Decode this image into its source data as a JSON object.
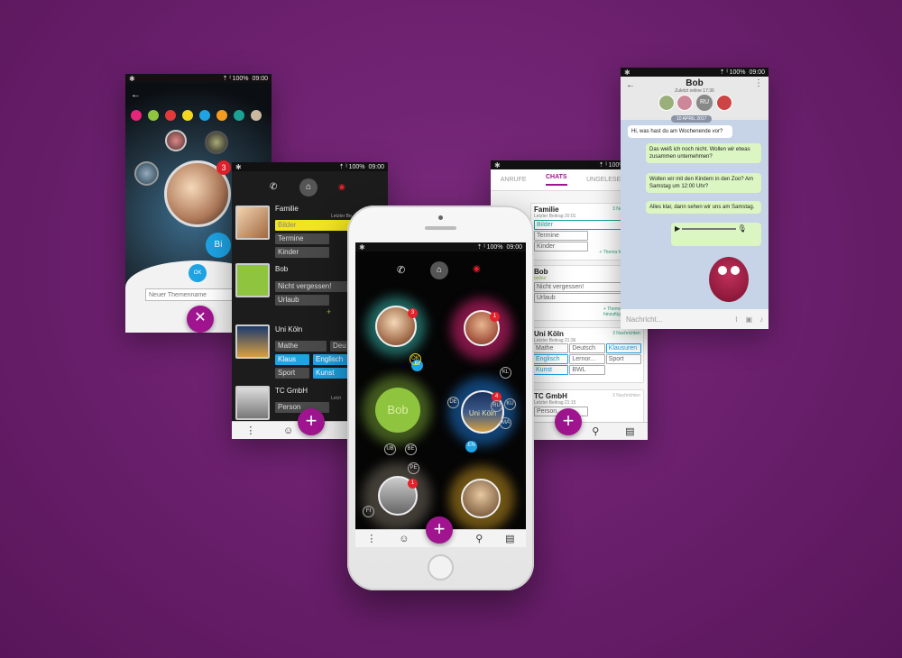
{
  "status": {
    "signal": "⇡ ᴵ 100%",
    "time": "09:00"
  },
  "colors": {
    "accent": "#a0158f",
    "badge": "#e5222c",
    "background": "#6a1f6c",
    "link": "#2aa07a"
  },
  "screenA": {
    "palette": [
      "#e8247b",
      "#8fc43f",
      "#e23a3a",
      "#f2d61f",
      "#1ea3e3",
      "#f39c20",
      "#1aa395",
      "#cbb8a0"
    ],
    "badge": "3",
    "bubble_label": "Bi",
    "ok_label": "OK",
    "topic_placeholder": "Neuer Themenname"
  },
  "screenB": {
    "groups": [
      {
        "name": "Familie",
        "meta": "Letzter Be",
        "tags": [
          "Bilder",
          "Termine",
          "Kinder"
        ]
      },
      {
        "name": "Bob",
        "meta": "",
        "tags": [
          "Nicht vergessen!",
          "Urlaub"
        ]
      },
      {
        "name": "Uni Köln",
        "meta": "",
        "tags": [
          "Mathe",
          "Deu",
          "Klaus",
          "Englisch",
          "Sport",
          "Kunst"
        ]
      },
      {
        "name": "TC GmbH",
        "meta": "Letzt",
        "tags": [
          "Person"
        ]
      }
    ],
    "plus": "+"
  },
  "screenC": {
    "tabs": [
      "ANRUFE",
      "CHATS",
      "UNGELESENE"
    ],
    "unread_badge": "9",
    "chats": [
      {
        "name": "Familie",
        "sub": "Letzter Beitrag 20:01",
        "count": "3 Nachrichten",
        "tags": [
          "Bilder",
          "Termine",
          "Kinder"
        ],
        "link": "+ Thema hinzufügen"
      },
      {
        "name": "Bob",
        "sub": "online",
        "count": "",
        "tags": [
          "Nicht vergessen!",
          "Urlaub"
        ],
        "link": "+ Thema hinzufügen"
      },
      {
        "name": "Uni Köln",
        "sub": "Letzter Beitrag 21:36",
        "count": "3 Nachrichten",
        "tags": [
          "Mathe",
          "Deutsch",
          "Klausuren",
          "Englisch",
          "Lernor...",
          "Sport",
          "Kunst",
          "BWL"
        ],
        "link": ""
      },
      {
        "name": "TC GmbH",
        "sub": "Letzter Beitrag 21:15",
        "count": "3 Nachrichten",
        "tags": [
          "Person..."
        ],
        "link": ""
      }
    ]
  },
  "screenD": {
    "name": "Bob",
    "last_seen": "Zuletzt online 17:36",
    "date_chip": "10 APRIL 2017",
    "ru": "RU",
    "messages": [
      {
        "text": "Hi, was hast du am Wochenende vor?",
        "time": "17:34"
      },
      {
        "text": "Das weiß ich noch nicht. Wollen wir etwas zusammen unternehmen?",
        "time": "17:36"
      },
      {
        "text": "Wollen wir mit den Kindern in den Zoo? Am Samstag um 12:00 Uhr?",
        "time": "17:37"
      },
      {
        "text": "Alles klar, dann sehen wir uns am Samstag.",
        "time": "17:38"
      }
    ],
    "input_placeholder": "Nachricht..."
  },
  "center": {
    "bubbles": [
      {
        "label": "3"
      },
      {
        "label": "1"
      },
      {
        "label": "Bob"
      },
      {
        "label": "Uni Köln",
        "badge": "4"
      },
      {
        "label": "1"
      },
      {
        "label": ""
      }
    ],
    "minis": [
      "KL",
      "KU",
      "DE",
      "MA",
      "EN",
      "BI",
      "OK",
      "UB",
      "BE",
      "PE",
      "FI",
      "VE",
      "RU"
    ],
    "fab": "+"
  }
}
